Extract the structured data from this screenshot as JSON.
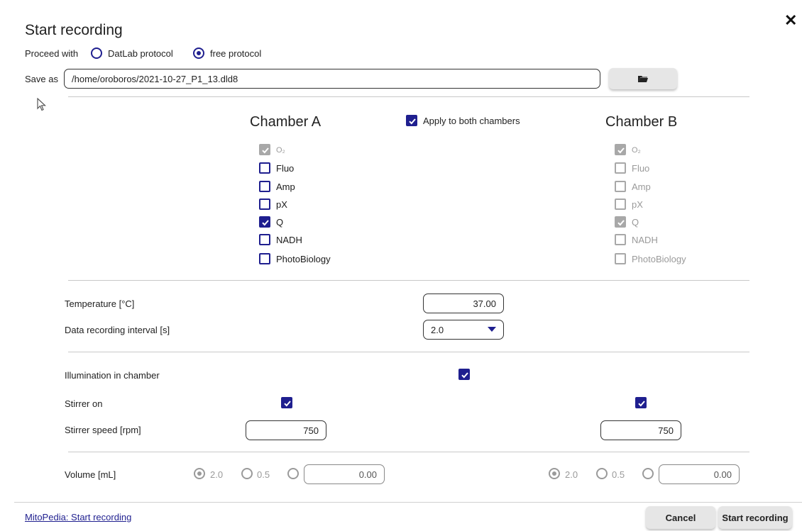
{
  "dialog": {
    "title": "Start recording",
    "close_icon": "close-icon"
  },
  "proceed": {
    "label": "Proceed with",
    "options": [
      "DatLab protocol",
      "free protocol"
    ],
    "selected": "free protocol"
  },
  "save_as": {
    "label": "Save as",
    "path": "/home/oroboros/2021-10-27_P1_13.dld8",
    "browse_icon": "folder-icon"
  },
  "chambers": {
    "apply_both_label": "Apply to both chambers",
    "apply_both": true,
    "a": {
      "title": "Chamber A",
      "options": [
        {
          "label": "O₂",
          "checked": true,
          "disabled": true
        },
        {
          "label": "Fluo",
          "checked": false,
          "disabled": false
        },
        {
          "label": "Amp",
          "checked": false,
          "disabled": false
        },
        {
          "label": "pX",
          "checked": false,
          "disabled": false
        },
        {
          "label": "Q",
          "checked": true,
          "disabled": false
        },
        {
          "label": "NADH",
          "checked": false,
          "disabled": false
        },
        {
          "label": "PhotoBiology",
          "checked": false,
          "disabled": false
        }
      ]
    },
    "b": {
      "title": "Chamber B",
      "options": [
        {
          "label": "O₂",
          "checked": true,
          "disabled": true
        },
        {
          "label": "Fluo",
          "checked": false,
          "disabled": true
        },
        {
          "label": "Amp",
          "checked": false,
          "disabled": true
        },
        {
          "label": "pX",
          "checked": false,
          "disabled": true
        },
        {
          "label": "Q",
          "checked": true,
          "disabled": true
        },
        {
          "label": "NADH",
          "checked": false,
          "disabled": true
        },
        {
          "label": "PhotoBiology",
          "checked": false,
          "disabled": true
        }
      ]
    }
  },
  "temperature": {
    "label": "Temperature [°C]",
    "value": "37.00"
  },
  "interval": {
    "label": "Data recording interval [s]",
    "value": "2.0"
  },
  "illumination": {
    "label": "Illumination in chamber",
    "checked": true
  },
  "stirrer": {
    "label": "Stirrer on",
    "a_checked": true,
    "b_checked": true
  },
  "stirrer_speed": {
    "label": "Stirrer speed [rpm]",
    "a": "750",
    "b": "750"
  },
  "volume": {
    "label": "Volume [mL]",
    "opt1": "2.0",
    "opt2": "0.5",
    "a": {
      "selected": "2.0",
      "custom": "0.00"
    },
    "b": {
      "selected": "2.0",
      "custom": "0.00"
    }
  },
  "footer": {
    "link": "MitoPedia: Start recording",
    "cancel": "Cancel",
    "start": "Start recording"
  },
  "colors": {
    "accent": "#1f1f8f",
    "disabled": "#a8a8a8",
    "button_bg": "#e6e6e6"
  }
}
